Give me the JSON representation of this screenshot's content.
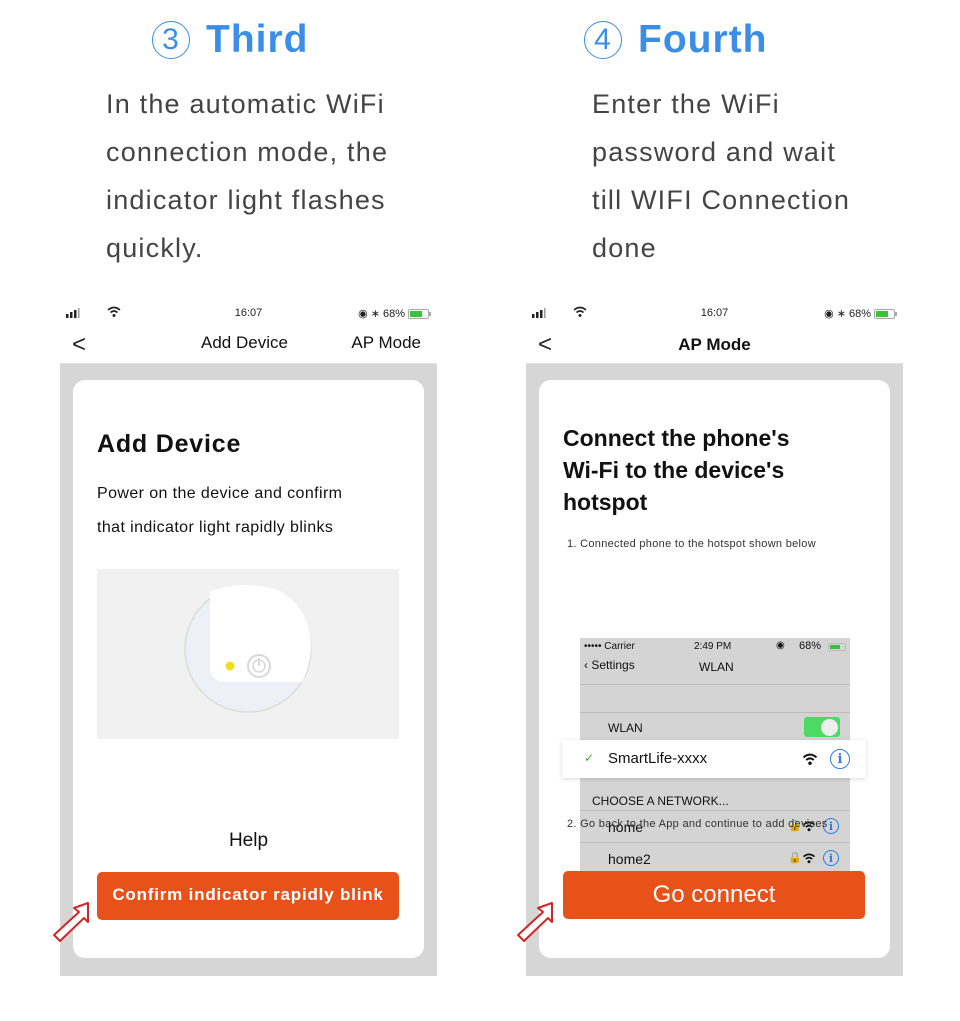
{
  "steps": [
    {
      "number": "3",
      "title": "Third",
      "description_lines": [
        "In the automatic WiFi",
        "connection mode, the",
        "indicator light flashes",
        "quickly."
      ]
    },
    {
      "number": "4",
      "title": "Fourth",
      "description_lines": [
        "Enter the WiFi",
        "password and wait",
        "till WIFI Connection",
        "done"
      ]
    }
  ],
  "phone_left": {
    "status": {
      "time": "16:07",
      "battery": "68%",
      "battery_level": 0.68
    },
    "nav": {
      "title": "Add Device",
      "right_action": "AP Mode",
      "back": "<"
    },
    "card": {
      "heading": "Add Device",
      "description_lines": [
        "Power on the device and confirm",
        "that indicator light rapidly blinks"
      ],
      "help_link": "Help",
      "confirm_button": "Confirm indicator rapidly blink"
    }
  },
  "phone_right": {
    "status": {
      "time": "16:07",
      "battery": "68%",
      "battery_level": 0.68
    },
    "nav": {
      "title": "AP Mode",
      "back": "<"
    },
    "card": {
      "heading_lines": [
        "Connect the phone's",
        "Wi-Fi to the device's",
        "hotspot"
      ],
      "instruction_1": "1. Connected phone to the hotspot shown below",
      "instruction_2": "2. Go back to the App and continue to add devices",
      "go_button": "Go connect"
    },
    "ios_settings": {
      "carrier": "••••• Carrier",
      "time": "2:49 PM",
      "battery": "68%",
      "back_label": "Settings",
      "title": "WLAN",
      "wlan_label": "WLAN",
      "wlan_enabled": true,
      "connected_network": "SmartLife-xxxx",
      "section_header": "CHOOSE A NETWORK...",
      "networks": [
        "home",
        "home2"
      ]
    }
  }
}
